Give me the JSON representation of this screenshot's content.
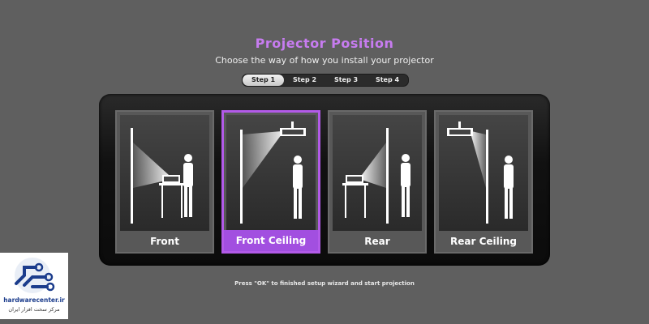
{
  "header": {
    "title": "Projector Position",
    "subtitle": "Choose the way of how you install your projector"
  },
  "steps": [
    "Step 1",
    "Step 2",
    "Step 3",
    "Step 4"
  ],
  "active_step": "Step 1",
  "options": [
    {
      "label": "Front",
      "selected": false
    },
    {
      "label": "Front Ceiling",
      "selected": true
    },
    {
      "label": "Rear",
      "selected": false
    },
    {
      "label": "Rear Ceiling",
      "selected": false
    }
  ],
  "footer": "Press \"OK\" to finished setup wizard and start projection",
  "watermark": {
    "site": "hardwarecenter.ir",
    "tagline": "مرکز سخت افزار ایران"
  },
  "colors": {
    "background": "#5f5f5f",
    "accent": "#b25ae8",
    "title": "#c77cf0"
  }
}
